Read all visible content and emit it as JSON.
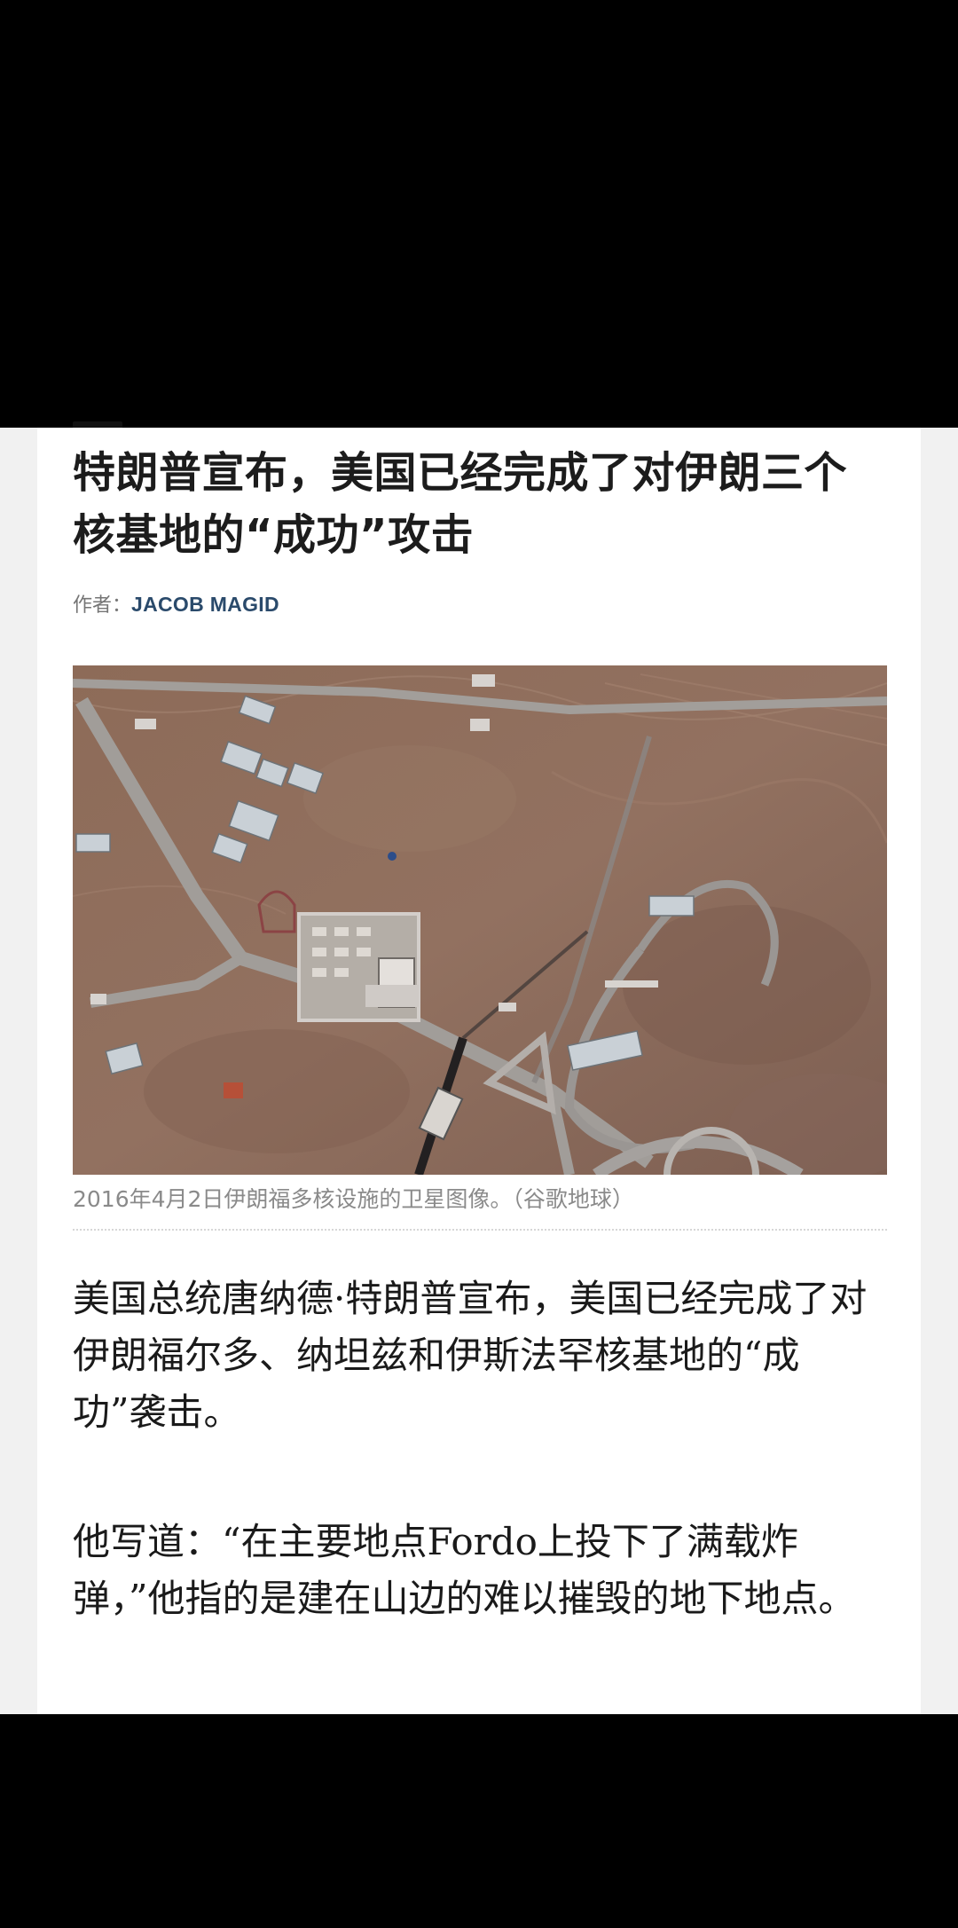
{
  "article": {
    "headline": "特朗普宣布，美国已经完成了对伊朗三个核基地的“成功”攻击",
    "byline_prefix": "作者：",
    "byline_author": "JACOB MAGID",
    "image": {
      "icon": "satellite-image",
      "colors": {
        "terrain": "#8a6a58",
        "roads": "#9c9898",
        "buildings": "#cfd3d6"
      }
    },
    "caption": "2016年4月2日伊朗福多核设施的卫星图像。（谷歌地球）",
    "paragraphs": [
      "美国总统唐纳德·特朗普宣布，美国已经完成了对伊朗福尔多、纳坦兹和伊斯法罕核基地的“成功”袭击。",
      "他写道：“在主要地点Fordo上投下了满载炸弹，”他指的是建在山边的难以摧毁的地下地点。"
    ]
  },
  "colors": {
    "headline": "#1c1c1c",
    "author": "#2a4a6b",
    "caption": "#8a8a8a",
    "body_text": "#1a1a1a",
    "card": "#ffffff",
    "page": "#f1f1f1"
  }
}
